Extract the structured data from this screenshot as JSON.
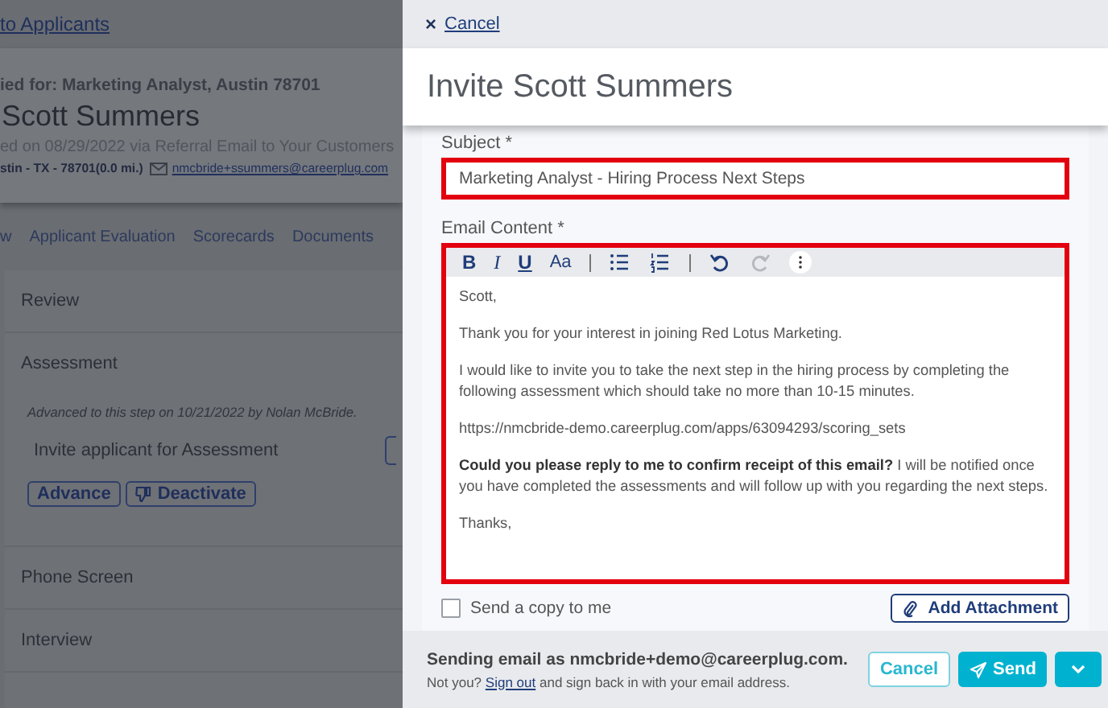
{
  "background": {
    "back_link": "to Applicants",
    "applicant": {
      "applied_for": "ied for: Marketing Analyst, Austin 78701",
      "name": "Scott Summers",
      "applied_on": "ed on 08/29/2022 via Referral Email to Your Customers",
      "location": "stin - TX - 78701(0.0 mi.)",
      "email": "nmcbride+ssummers@careerplug.com"
    },
    "tabs": [
      {
        "label": "w",
        "selected": false
      },
      {
        "label": "Applicant Evaluation",
        "selected": false
      },
      {
        "label": "Scorecards",
        "selected": false
      },
      {
        "label": "Documents",
        "selected": false
      }
    ],
    "steps": [
      {
        "title": "Review"
      },
      {
        "title": "Assessment",
        "note": "Advanced to this step on 10/21/2022 by Nolan McBride.",
        "task": "Invite applicant for Assessment",
        "buttons": [
          {
            "label": "Advance",
            "kind": "plain"
          },
          {
            "label": "Deactivate",
            "kind": "thumbs-down"
          }
        ]
      },
      {
        "title": "Phone Screen"
      },
      {
        "title": "Interview"
      }
    ]
  },
  "panel": {
    "cancel_link": "Cancel",
    "close_glyph": "×",
    "title": "Invite Scott Summers",
    "subject": {
      "label": "Subject *",
      "value": "Marketing Analyst - Hiring Process Next Steps"
    },
    "email_content": {
      "label": "Email Content *",
      "toolbar": [
        {
          "kind": "bold",
          "label": "B"
        },
        {
          "kind": "italic",
          "label": "I"
        },
        {
          "kind": "underline",
          "label": "U"
        },
        {
          "kind": "font-size",
          "label": "Aa"
        },
        {
          "kind": "separator"
        },
        {
          "kind": "bullets"
        },
        {
          "kind": "numbers"
        },
        {
          "kind": "separator"
        },
        {
          "kind": "undo",
          "disabled": false
        },
        {
          "kind": "redo",
          "disabled": true
        },
        {
          "kind": "more"
        }
      ],
      "paragraphs": [
        "Scott,",
        "Thank you for your interest in joining Red Lotus Marketing.",
        "I would like to invite you to take the next step in the hiring process by completing the following assessment which should take no more than 10-15 minutes.",
        "https://nmcbride-demo.careerplug.com/apps/63094293/scoring_sets",
        "**Could you please reply to me to confirm receipt of this email?** I will be notified once you have completed the assessments and will follow up with you regarding the next steps.",
        "Thanks,"
      ]
    },
    "send_copy": {
      "label": "Send a copy to me",
      "checked": false
    },
    "add_attachment": "Add Attachment",
    "footer": {
      "sender": "Sending email as nmcbride+demo@careerplug.com.",
      "not_you": "Not you?",
      "sign_out": "Sign out",
      "rest": "and sign back in with your email address.",
      "cancel": "Cancel",
      "send": "Send"
    }
  }
}
